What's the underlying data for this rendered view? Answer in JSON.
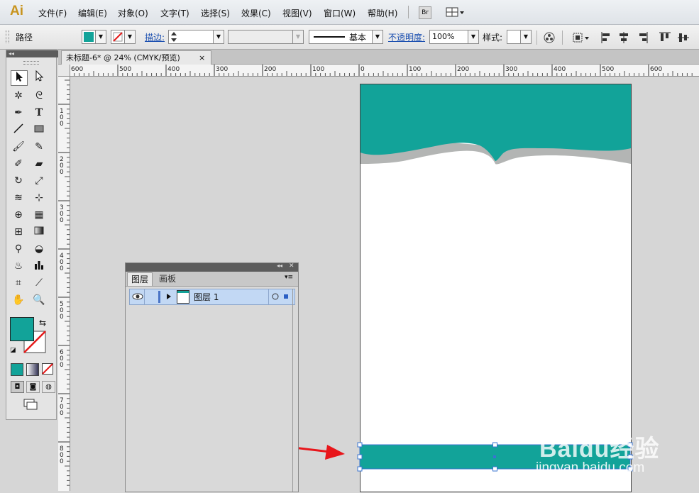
{
  "app": {
    "logo": "Ai",
    "menus": [
      "文件(F)",
      "编辑(E)",
      "对象(O)",
      "文字(T)",
      "选择(S)",
      "效果(C)",
      "视图(V)",
      "窗口(W)",
      "帮助(H)"
    ],
    "bridge_button": "Br"
  },
  "control": {
    "selection_type": "路径",
    "stroke_label": "描边:",
    "stroke_style": "基本",
    "opacity_label": "不透明度:",
    "opacity_value": "100%",
    "style_label": "样式:"
  },
  "document": {
    "tab_title": "未标题-6* @ 24% (CMYK/预览)",
    "close": "×"
  },
  "ruler": {
    "h_labels": [
      "600",
      "500",
      "400",
      "300",
      "200",
      "100",
      "0",
      "100",
      "200",
      "300",
      "400",
      "500",
      "600"
    ],
    "v_labels": [
      "1\n0\n0",
      "2\n0\n0",
      "3\n0\n0",
      "4\n0\n0",
      "5\n0\n0",
      "6\n0\n0",
      "7\n0\n0",
      "8\n0\n0"
    ]
  },
  "layers_panel": {
    "tabs": [
      "图层",
      "画板"
    ],
    "layer_name": "图层 1",
    "collapse": "◂◂",
    "close": "✕",
    "menu": "▾≡"
  },
  "colors": {
    "teal": "#12a399",
    "gray_band": "#b3b5b4",
    "arrow": "#e8161b"
  },
  "watermark": {
    "brand": "Baidu经验",
    "url": "jingyan.baidu.com"
  }
}
